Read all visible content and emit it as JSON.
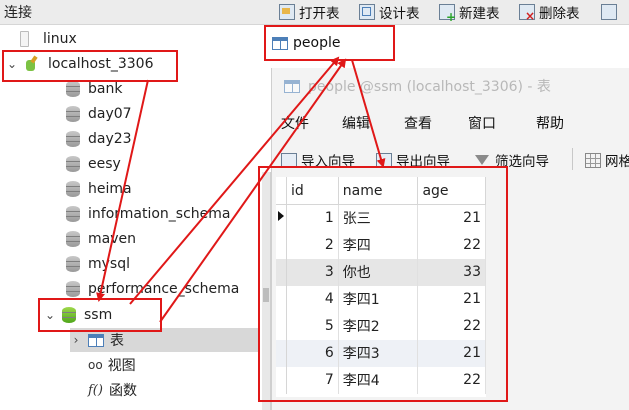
{
  "sidebar": {
    "header": "连接",
    "items": [
      {
        "label": "linux"
      },
      {
        "label": "localhost_3306"
      },
      {
        "label": "bank"
      },
      {
        "label": "day07"
      },
      {
        "label": "day23"
      },
      {
        "label": "eesy"
      },
      {
        "label": "heima"
      },
      {
        "label": "information_schema"
      },
      {
        "label": "maven"
      },
      {
        "label": "mysql"
      },
      {
        "label": "performance_schema"
      },
      {
        "label": "ssm"
      },
      {
        "label": "表"
      },
      {
        "label": "视图"
      },
      {
        "label": "函数"
      }
    ]
  },
  "toolbar": {
    "open": "打开表",
    "design": "设计表",
    "new": "新建表",
    "delete": "删除表"
  },
  "tab": {
    "label": "people"
  },
  "window": {
    "title": "people @ssm (localhost_3306) - 表",
    "menu": [
      "文件",
      "编辑",
      "查看",
      "窗口",
      "帮助"
    ],
    "toolbar": {
      "import": "导入向导",
      "export": "导出向导",
      "filter": "筛选向导",
      "grid": "网格"
    }
  },
  "grid": {
    "columns": [
      "id",
      "name",
      "age"
    ],
    "rows": [
      {
        "id": "1",
        "name": "张三",
        "age": "21"
      },
      {
        "id": "2",
        "name": "李四",
        "age": "22"
      },
      {
        "id": "3",
        "name": "你也",
        "age": "33"
      },
      {
        "id": "4",
        "name": "李四1",
        "age": "21"
      },
      {
        "id": "5",
        "name": "李四2",
        "age": "22"
      },
      {
        "id": "6",
        "name": "李四3",
        "age": "21"
      },
      {
        "id": "7",
        "name": "李四4",
        "age": "22"
      }
    ]
  },
  "colors": {
    "annotation": "#e01818",
    "selection": "#d8d8d8",
    "accent": "#4d7fb8"
  }
}
